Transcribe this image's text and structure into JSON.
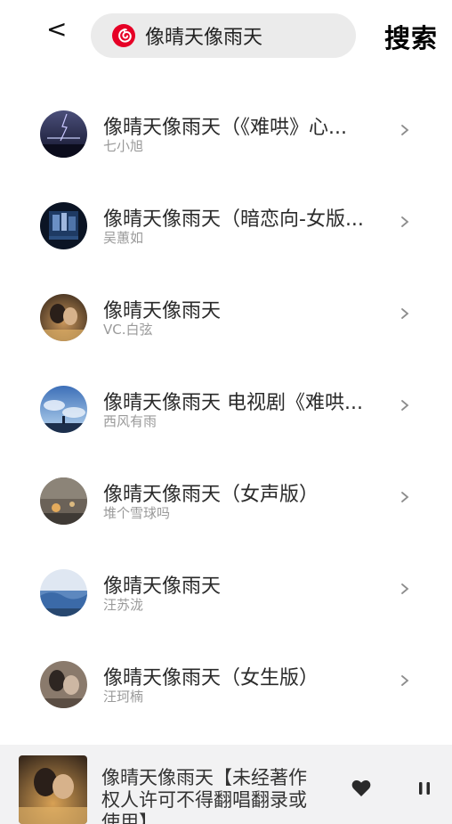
{
  "header": {
    "back_label": "<",
    "search_query": "像晴天像雨天",
    "search_button": "搜索",
    "app_logo_icon": "netease-music-logo-icon"
  },
  "results": [
    {
      "title": "像晴天像雨天（《难哄》心...",
      "artist": "七小旭",
      "cover": "night-lightning-cover"
    },
    {
      "title": "像晴天像雨天（暗恋向-女版...",
      "artist": "吴蕙如",
      "cover": "city-night-cover"
    },
    {
      "title": "像晴天像雨天",
      "artist": "VC.白弦",
      "cover": "couple-warm-cover"
    },
    {
      "title": "像晴天像雨天 电视剧《难哄...",
      "artist": "西风有雨",
      "cover": "sky-clouds-cover"
    },
    {
      "title": "像晴天像雨天（女声版）",
      "artist": "堆个雪球吗",
      "cover": "rainy-street-cover"
    },
    {
      "title": "像晴天像雨天",
      "artist": "汪苏泷",
      "cover": "blue-landscape-cover"
    },
    {
      "title": "像晴天像雨天（女生版）",
      "artist": "汪珂楠",
      "cover": "couple-sepia-cover"
    }
  ],
  "player": {
    "title": "像晴天像雨天【未经著作权人许可不得翻唱翻录或使用】",
    "like_icon": "heart-icon",
    "pause_icon": "pause-icon"
  },
  "colors": {
    "accent": "#e60026",
    "search_bg": "#ebebeb",
    "player_bg": "#f2f2f3"
  }
}
